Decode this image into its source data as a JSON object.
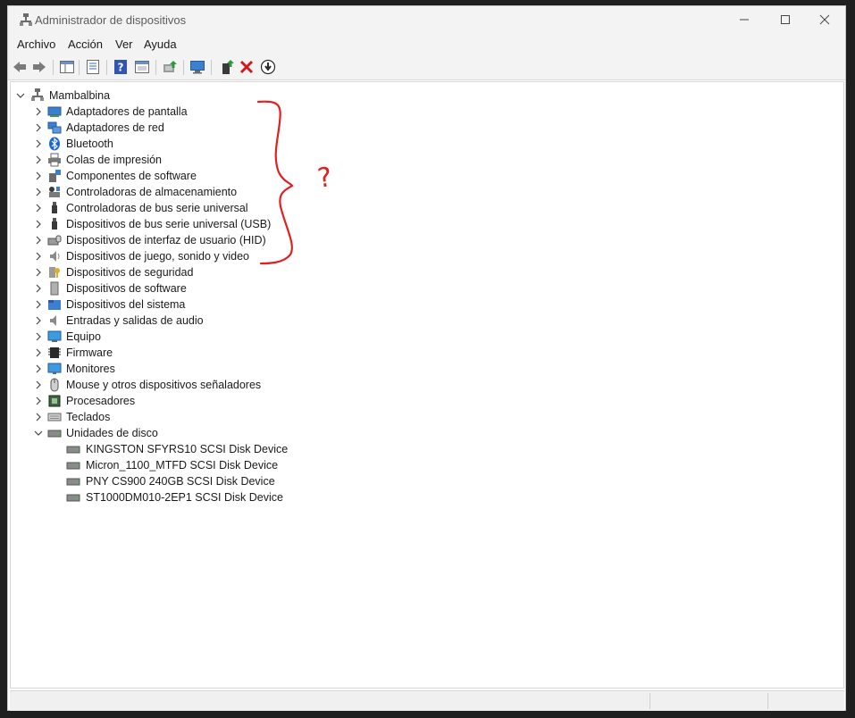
{
  "window": {
    "title": "Administrador de dispositivos"
  },
  "menu": [
    "Archivo",
    "Acción",
    "Ver",
    "Ayuda"
  ],
  "tree": {
    "root": "Mambalbina",
    "categories": [
      {
        "label": "Adaptadores de pantalla",
        "icon": "display-adapter-icon"
      },
      {
        "label": "Adaptadores de red",
        "icon": "network-adapter-icon"
      },
      {
        "label": "Bluetooth",
        "icon": "bluetooth-icon"
      },
      {
        "label": "Colas de impresión",
        "icon": "printer-icon"
      },
      {
        "label": "Componentes de software",
        "icon": "software-component-icon"
      },
      {
        "label": "Controladoras de almacenamiento",
        "icon": "storage-controller-icon"
      },
      {
        "label": "Controladoras de bus serie universal",
        "icon": "usb-controller-icon"
      },
      {
        "label": "Dispositivos de bus serie universal (USB)",
        "icon": "usb-device-icon"
      },
      {
        "label": "Dispositivos de interfaz de usuario (HID)",
        "icon": "hid-icon"
      },
      {
        "label": "Dispositivos de juego, sonido y video",
        "icon": "speaker-icon"
      },
      {
        "label": "Dispositivos de seguridad",
        "icon": "security-key-icon"
      },
      {
        "label": "Dispositivos de software",
        "icon": "software-device-icon"
      },
      {
        "label": "Dispositivos del sistema",
        "icon": "system-folder-icon"
      },
      {
        "label": "Entradas y salidas de audio",
        "icon": "audio-io-icon"
      },
      {
        "label": "Equipo",
        "icon": "computer-icon"
      },
      {
        "label": "Firmware",
        "icon": "firmware-chip-icon"
      },
      {
        "label": "Monitores",
        "icon": "monitor-icon"
      },
      {
        "label": "Mouse y otros dispositivos señaladores",
        "icon": "mouse-icon"
      },
      {
        "label": "Procesadores",
        "icon": "processor-icon"
      },
      {
        "label": "Teclados",
        "icon": "keyboard-icon"
      },
      {
        "label": "Unidades de disco",
        "icon": "disk-drive-icon",
        "expanded": true
      }
    ],
    "disks": [
      "KINGSTON SFYRS10 SCSI Disk Device",
      "Micron_1100_MTFD SCSI Disk Device",
      "PNY CS900 240GB SCSI Disk Device",
      "ST1000DM010-2EP1 SCSI Disk Device"
    ]
  },
  "annotation": {
    "text": "?",
    "color": "#e02020"
  }
}
